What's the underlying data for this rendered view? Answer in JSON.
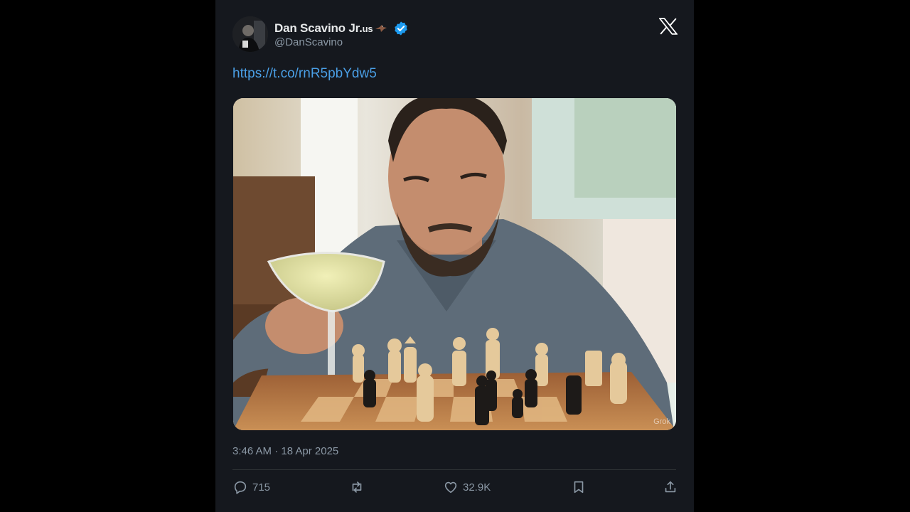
{
  "author": {
    "display_name": "Dan Scavino Jr.",
    "flag_code": "us",
    "handle": "@DanScavino",
    "verified": true,
    "badge_color": "#1d9bf0"
  },
  "header": {
    "logo_icon": "x-logo-icon"
  },
  "tweet": {
    "link_text": "https://t.co/rnR5pbYdw5",
    "media_watermark": "Grok",
    "timestamp": "3:46 AM · 18 Apr 2025"
  },
  "actions": {
    "reply_count": "715",
    "retweet_count": "",
    "like_count": "32.9K",
    "icons": [
      "reply-icon",
      "retweet-icon",
      "like-icon",
      "bookmark-icon",
      "share-icon"
    ]
  },
  "colors": {
    "background": "#15181e",
    "text_primary": "#e7e9ea",
    "text_secondary": "#8b98a5",
    "link": "#4a9fe6"
  }
}
